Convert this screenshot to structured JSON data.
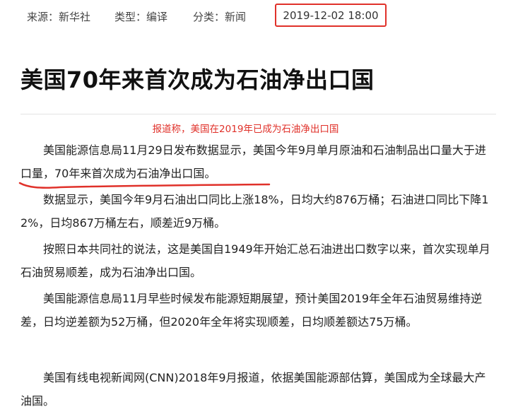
{
  "meta": {
    "source": "来源：新华社",
    "type": "类型：编译",
    "category": "分类：新闻",
    "datetime": "2019-12-02 18:00"
  },
  "article": {
    "title": "美国70年来首次成为石油净出口国",
    "caption": "报道称，美国在2019年已成为石油净出口国",
    "paragraphs": [
      "美国能源信息局11月29日发布数据显示，美国今年9月单月原油和石油制品出口量大于进口量，70年来首次成为石油净出口国。",
      "数据显示，美国今年9月石油出口同比上涨18%，日均大约876万桶；石油进口同比下降12%，日均867万桶左右，顺差近9万桶。",
      "按照日本共同社的说法，这是美国自1949年开始汇总石油进出口数字以来，首次实现单月石油贸易顺差，成为石油净出口国。",
      "美国能源信息局11月早些时候发布能源短期展望，预计美国2019年全年石油贸易维持逆差，日均逆差额为52万桶，但2020年全年将实现顺差，日均顺差额达75万桶。",
      "美国有线电视新闻网(CNN)2018年9月报道，依据美国能源部估算，美国成为全球最大产油国。"
    ]
  },
  "colors": {
    "highlight": "#e0312a"
  }
}
